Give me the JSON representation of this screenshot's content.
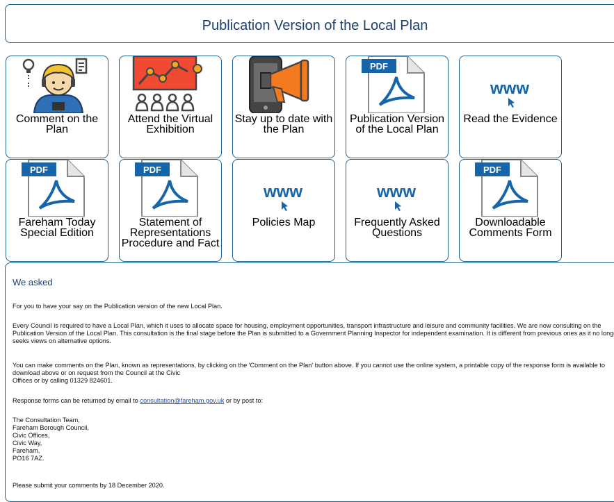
{
  "page": {
    "title": "Publication Version of the Local Plan"
  },
  "tiles": [
    {
      "label": "Comment on the Plan",
      "icon": "commenter-person-icon"
    },
    {
      "label": "Attend the Virtual Exhibition",
      "icon": "presentation-audience-icon"
    },
    {
      "label": "Stay up to date with the Plan",
      "icon": "phone-megaphone-icon"
    },
    {
      "label": "Publication Version of the Local Plan",
      "icon": "pdf-icon"
    },
    {
      "label": "Read the Evidence",
      "icon": "www-link-icon"
    },
    {
      "label": "Fareham Today Special Edition",
      "icon": "pdf-icon"
    },
    {
      "label": "Statement of Representations Procedure and Fact",
      "icon": "pdf-icon"
    },
    {
      "label": "Policies Map",
      "icon": "www-link-icon"
    },
    {
      "label": "Frequently Asked Questions",
      "icon": "www-link-icon"
    },
    {
      "label": "Downloadable Comments Form",
      "icon": "pdf-icon"
    }
  ],
  "icons": {
    "pdf_badge": "PDF",
    "www_text": "www"
  },
  "colors": {
    "accent": "#1f5f8b",
    "title": "#1f3f6e",
    "link": "#1a4fb5",
    "pdf_blue": "#1565a8"
  },
  "content": {
    "heading": "We asked",
    "p1": "For you to have your say on the Publication version of the new Local Plan.",
    "p2": "Every Council is required to have a Local Plan, which it uses to allocate space for housing, employment opportunities, transport infrastructure and leisure and community facilities. We are now consulting on the Publication Version of the Local Plan. This consultation is the final stage before the Plan is submitted to a Government Planning Inspector for independent examination. It is different from previous ones as it no longer seeks views on alternative options.",
    "p3_line1": "You can make comments on the Plan, known as representations, by clicking on the 'Comment on the Plan' button above. If you cannot use the online system, a printable copy of the response form is available to download above or on request from the Council at the Civic",
    "p3_line2": "Offices or by calling 01329 824601.",
    "p4_before": "Response forms can be returned by email to ",
    "p4_link": "consultation@fareham.gov.uk",
    "p4_after": " or by post to:",
    "address": [
      "The Consultation Team,",
      "Fareham Borough Council,",
      "Civic Offices,",
      "Civic Way,",
      "Fareham,",
      "PO16 7AZ."
    ],
    "p5": "Please submit your comments by 18 December 2020."
  }
}
